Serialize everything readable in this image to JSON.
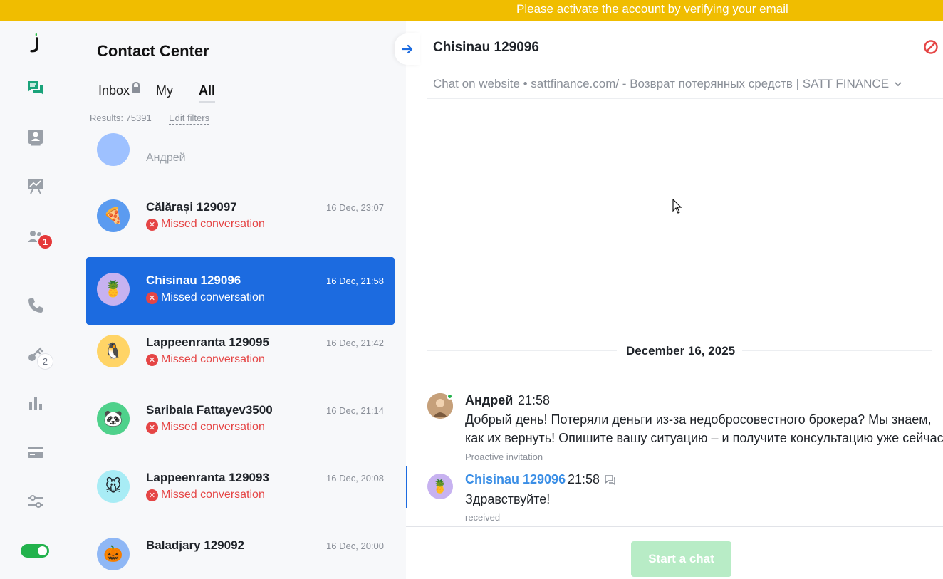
{
  "banner": {
    "text": "Please activate the account by ",
    "link": "verifying your email"
  },
  "colors": {
    "accent": "#1c6be0",
    "banner": "#f0bd00",
    "missed": "#e54545",
    "online": "#22b24c",
    "logo": "#2bbf4a"
  },
  "rail": {
    "items": [
      {
        "icon": "logo-icon"
      },
      {
        "icon": "chats-icon"
      },
      {
        "icon": "contacts-icon"
      },
      {
        "icon": "presentation-icon"
      },
      {
        "icon": "team-icon",
        "badge": "1"
      },
      {
        "icon": "phone-icon"
      },
      {
        "icon": "bots-icon",
        "badge": "2"
      },
      {
        "icon": "reports-icon"
      },
      {
        "icon": "billing-icon"
      },
      {
        "icon": "settings-icon"
      },
      {
        "icon": "status-toggle"
      }
    ]
  },
  "list": {
    "title": "Contact Center",
    "tabs": [
      {
        "label": "Inbox"
      },
      {
        "label": "My"
      },
      {
        "label": "All"
      }
    ],
    "results_label": "Results: 75391",
    "edit_filters": "Edit filters",
    "partial_item": "Андрей",
    "items": [
      {
        "name": "Călărași 129097",
        "time": "16 Dec, 23:07",
        "status": "Missed conversation",
        "avatar": "🍕",
        "avatar_bg": "#5b9bf0"
      },
      {
        "name": "Chisinau 129096",
        "time": "16 Dec, 21:58",
        "status": "Missed conversation",
        "avatar": "🍍",
        "avatar_bg": "#c7b2f0"
      },
      {
        "name": "Lappeenranta 129095",
        "time": "16 Dec, 21:42",
        "status": "Missed conversation",
        "avatar": "🐧",
        "avatar_bg": "#ffd466"
      },
      {
        "name": "Saribala Fattayev3500",
        "time": "16 Dec, 21:14",
        "status": "Missed conversation",
        "avatar": "🐼",
        "avatar_bg": "#4fd18b"
      },
      {
        "name": "Lappeenranta 129093",
        "time": "16 Dec, 20:08",
        "status": "Missed conversation",
        "avatar": "🐭",
        "avatar_bg": "#a8ecf5"
      },
      {
        "name": "Baladjary 129092",
        "time": "16 Dec, 20:00",
        "status": "",
        "avatar": "🎃",
        "avatar_bg": "#8fb7f5"
      }
    ]
  },
  "chat": {
    "title": "Chisinau 129096",
    "subtitle": "Chat on website • sattfinance.com/ - Возврат потерянных средств | SATT FINANCE",
    "date": "December 16, 2025",
    "messages": [
      {
        "author": "Андрей",
        "time": "21:58",
        "lines": [
          "Добрый день! Потеряли деньги из-за недобросовестного брокера? Мы знаем,",
          "как их вернуть! Опишите вашу ситуацию – и получите консультацию уже сейчас."
        ],
        "meta": "Proactive invitation"
      },
      {
        "author": "Chisinau 129096",
        "time": "21:58",
        "lines": [
          "Здравствуйте!"
        ],
        "meta": "received",
        "avatar": "🍍"
      }
    ],
    "start_button": "Start a chat"
  }
}
